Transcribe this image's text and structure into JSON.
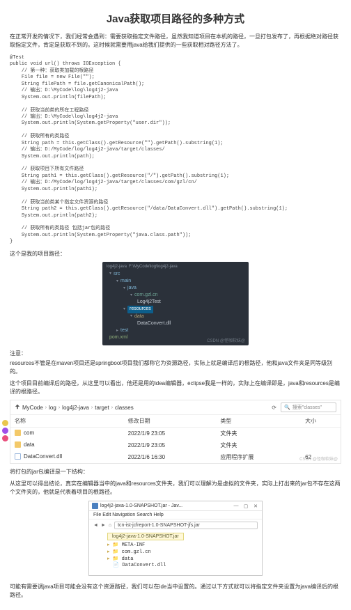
{
  "title": "Java获取项目路径的多种方式",
  "intro": "在正常开发的情况下，我们经常会遇到：需要获取指定文件路径，虽然我知道项目在本机的路径，一旦打包发布了，再根据绝对路径获取指定文件，肯定是获取不到的。这时候就需要用java给我们提供的一些获取相对路径方法了。",
  "code": "@Test\npublic void url() throws IOException {\n    // 第一种：获取类加载的根路径\n    File file = new File(\"\");\n    String filePath = file.getCanonicalPath();\n    // 输出：D:\\MyCode\\log\\log4j2-java\n    System.out.println(filePath);\n\n    // 获取当前类的所在工程路径\n    // 输出：D:\\MyCode\\log\\log4j2-java\n    System.out.println(System.getProperty(\"user.dir\"));\n\n    // 获取所有的类路径\n    String path = this.getClass().getResource(\"\").getPath().substring(1);\n    // 输出：D:/MyCode/log/log4j2-java/target/classes/\n    System.out.println(path);\n\n    // 获取项目下所有文件路径\n    String path1 = this.getClass().getResource(\"/\").getPath().substring(1);\n    // 输出：D:/MyCode/log/log4j2-java/target/classes/com/gzl/cn/\n    System.out.println(path1);\n\n    // 获取当前类某个指定文件资源的路径\n    String path2 = this.getClass().getResource(\"/data/DataConvert.dll\").getPath().substring(1);\n    System.out.println(path2);\n\n    // 获取所有的类路径 包括jar包的路径\n    System.out.println(System.getProperty(\"java.class.path\"));\n}",
  "caption1": "这个是我的项目路径：",
  "ide": {
    "path_left": "log4j2-java",
    "path_right": "F:\\MyCode\\log\\log4j2-java",
    "nodes": {
      "src": "src",
      "main": "main",
      "java": "java",
      "pkg": "com.gzl.cn",
      "class": "Log4j2Test",
      "resources": "resources",
      "data": "data",
      "dll": "DataConvert.dll",
      "test": "test",
      "pom": "pom.xml"
    },
    "watermark": "CSDN @怪咖软妹@"
  },
  "notice_label": "注意：",
  "notice1": "resources不管是在maven项目还是springboot项目我们都称它为资源路径，实际上就是编译后的根路径，他和java文件夹是同等级别的。",
  "notice2": "这个项目目前编译后的路径，从这里可以看出，他还是用的idea编辑器，eclipse我是一样的，实际上在编译即是，java和resources是编译的根路径。",
  "explorer": {
    "crumbs": [
      "MyCode",
      "log",
      "log4j2-java",
      "target",
      "classes"
    ],
    "search_placeholder": "搜索\"classes\"",
    "cols": {
      "name": "名称",
      "date": "修改日期",
      "type": "类型",
      "size": "大小"
    },
    "rows": [
      {
        "name": "com",
        "date": "2022/1/9 23:05",
        "type": "文件夹",
        "size": ""
      },
      {
        "name": "data",
        "date": "2022/1/9 23:05",
        "type": "文件夹",
        "size": ""
      },
      {
        "name": "DataConvert.dll",
        "date": "2022/1/6 16:30",
        "type": "应用程序扩展",
        "size": "62"
      }
    ],
    "watermark": "CSDN @怪咖软妹@"
  },
  "caption2": "将打包的jar包编译是一下结构：",
  "caption3": "从这里可以得出结论，真实在编辑器当中的java和resources文件夹，我们可以理解为是虚拟的文件夹，实际上打出来的jar包不存在这两个文件夹的，他就是代表着项目的根路径。",
  "jar": {
    "title": "log4j2-java-1.0-SNAPSHOT.jar - Jav...",
    "menu": "File Edit Navigation Search Help",
    "addr": "tcn-ist-jcfreport-1.0-SNAPSHOT-jfs.jar",
    "tab": "log4j2-java-1.0-SNAPSHOT.jar",
    "items": {
      "meta": "META-INF",
      "com": "com.gzl.cn",
      "data": "data",
      "dll": "DataConvert.dll"
    }
  },
  "footer": "可能有需要调java项目可能会没有这个资源路径，我们可以在ide当中设置的。通过以下方式就可以将指定文件夹设置为java编译后的根路径。"
}
